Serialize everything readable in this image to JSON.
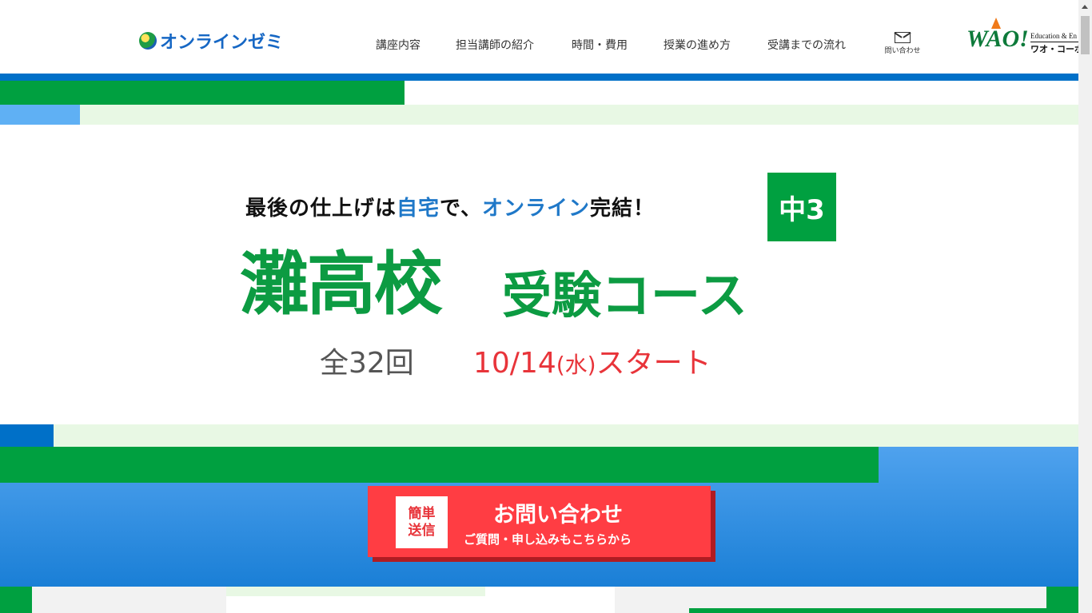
{
  "colors": {
    "brand_blue": "#0070c8",
    "brand_green": "#00a040",
    "light_green": "#e8f8e4",
    "sky_blue": "#4fa2ee",
    "accent_red": "#ff3d43"
  },
  "header": {
    "logo_text": "オンラインゼミ",
    "nav": [
      {
        "label": "講座内容"
      },
      {
        "label": "担当講師の紹介"
      },
      {
        "label": "時間・費用"
      },
      {
        "label": "授業の進め方"
      },
      {
        "label": "受講までの流れ"
      }
    ],
    "contact_label": "問い合わせ",
    "contact_icon": "mail-icon",
    "partner": {
      "brand": "WAO!",
      "tagline": "Education & En",
      "name": "ワオ・コーポレ"
    }
  },
  "hero": {
    "tagline_pre": "最後の仕上げは",
    "tagline_home": "自宅",
    "tagline_mid": "で、",
    "tagline_online": "オンライン",
    "tagline_post": "完結！",
    "grade": "中3",
    "school": "灘高校",
    "course": "受験コース",
    "sessions": "全32回",
    "start_date": "10/14",
    "start_day": "(水)",
    "start_suffix": "スタート"
  },
  "cta": {
    "badge_line1": "簡単",
    "badge_line2": "送信",
    "main": "お問い合わせ",
    "sub": "ご質問・申し込みもこちらから"
  }
}
